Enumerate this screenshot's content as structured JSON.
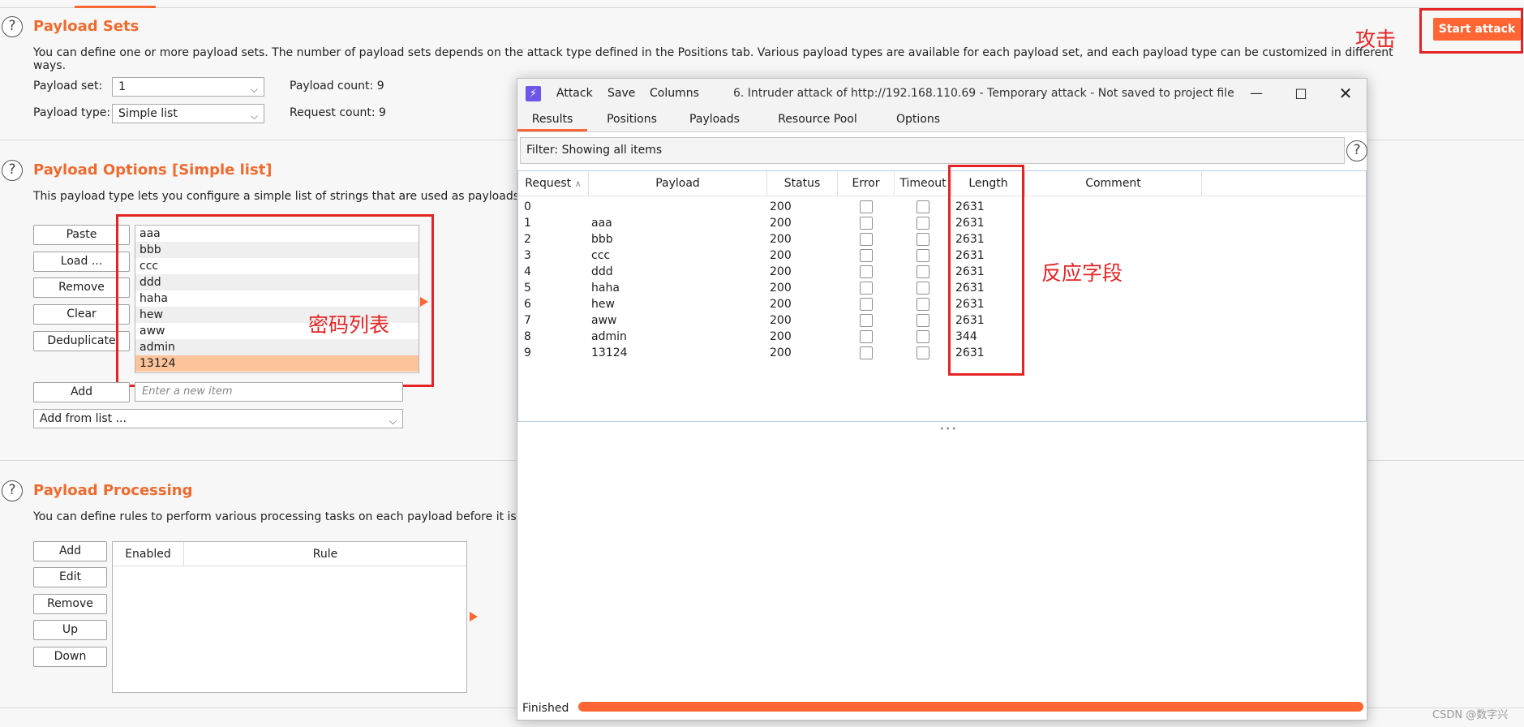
{
  "payload_sets": {
    "title": "Payload Sets",
    "description": "You can define one or more payload sets. The number of payload sets depends on the attack type defined in the Positions tab. Various payload types are available for each payload set, and each payload type can be customized in different ways.",
    "set_label": "Payload set:",
    "set_value": "1",
    "type_label": "Payload type:",
    "type_value": "Simple list",
    "count_label": "Payload count: 9",
    "request_label": "Request count: 9"
  },
  "payload_options": {
    "title": "Payload Options [Simple list]",
    "description": "This payload type lets you configure a simple list of strings that are used as payloads.",
    "buttons": [
      "Paste",
      "Load ...",
      "Remove",
      "Clear",
      "Deduplicate"
    ],
    "items": [
      "aaa",
      "bbb",
      "ccc",
      "ddd",
      "haha",
      "hew",
      "aww",
      "admin",
      "13124"
    ],
    "add_label": "Add",
    "add_placeholder": "Enter a new item",
    "add_from_list": "Add from list ..."
  },
  "payload_processing": {
    "title": "Payload Processing",
    "description": "You can define rules to perform various processing tasks on each payload before it is use",
    "buttons": [
      "Add",
      "Edit",
      "Remove",
      "Up",
      "Down"
    ],
    "columns": [
      "Enabled",
      "Rule"
    ]
  },
  "start_attack": "Start attack",
  "annotations": {
    "attack": "攻击",
    "password_list": "密码列表",
    "response_field": "反应字段"
  },
  "attack_window": {
    "menu": [
      "Attack",
      "Save",
      "Columns"
    ],
    "title": "6. Intruder attack of http://192.168.110.69 - Temporary attack - Not saved to project file",
    "tabs": [
      "Results",
      "Positions",
      "Payloads",
      "Resource Pool",
      "Options"
    ],
    "filter": "Filter: Showing all items",
    "columns": [
      "Request",
      "Payload",
      "Status",
      "Error",
      "Timeout",
      "Length",
      "Comment"
    ],
    "rows": [
      {
        "request": "0",
        "payload": "",
        "status": "200",
        "length": "2631"
      },
      {
        "request": "1",
        "payload": "aaa",
        "status": "200",
        "length": "2631"
      },
      {
        "request": "2",
        "payload": "bbb",
        "status": "200",
        "length": "2631"
      },
      {
        "request": "3",
        "payload": "ccc",
        "status": "200",
        "length": "2631"
      },
      {
        "request": "4",
        "payload": "ddd",
        "status": "200",
        "length": "2631"
      },
      {
        "request": "5",
        "payload": "haha",
        "status": "200",
        "length": "2631"
      },
      {
        "request": "6",
        "payload": "hew",
        "status": "200",
        "length": "2631"
      },
      {
        "request": "7",
        "payload": "aww",
        "status": "200",
        "length": "2631"
      },
      {
        "request": "8",
        "payload": "admin",
        "status": "200",
        "length": "344"
      },
      {
        "request": "9",
        "payload": "13124",
        "status": "200",
        "length": "2631"
      }
    ],
    "status_text": "Finished",
    "progress": 1.0
  },
  "watermark": "CSDN @数字兴"
}
